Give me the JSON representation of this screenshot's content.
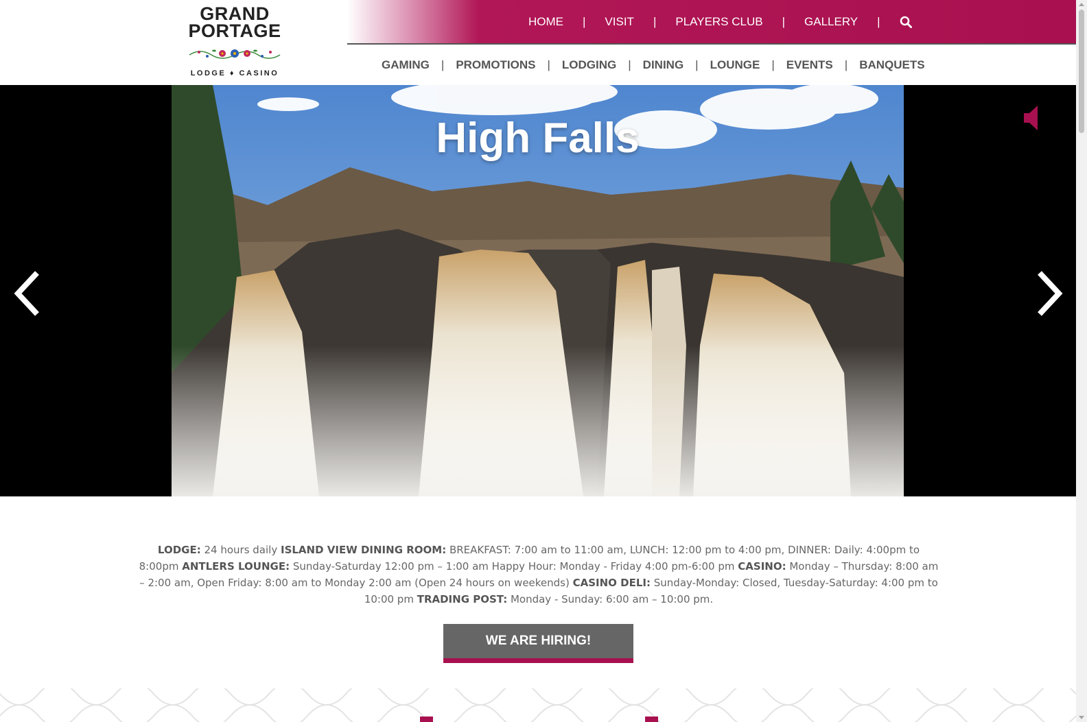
{
  "logo": {
    "line1": "GRAND",
    "line2": "PORTAGE",
    "subtitle": "LODGE ♦ CASINO"
  },
  "top_nav": {
    "items": [
      {
        "label": "HOME"
      },
      {
        "label": "VISIT"
      },
      {
        "label": "PLAYERS CLUB"
      },
      {
        "label": "GALLERY"
      }
    ],
    "separator": "|",
    "search_icon": "search-icon"
  },
  "main_nav": {
    "items": [
      {
        "label": "GAMING"
      },
      {
        "label": "PROMOTIONS"
      },
      {
        "label": "LODGING"
      },
      {
        "label": "DINING"
      },
      {
        "label": "LOUNGE"
      },
      {
        "label": "EVENTS"
      },
      {
        "label": "BANQUETS"
      }
    ],
    "separator": "|"
  },
  "hero": {
    "title": "High Falls",
    "prev_icon": "chevron-left-icon",
    "next_icon": "chevron-right-icon",
    "mute_icon": "speaker-mute-icon"
  },
  "hours": {
    "lodge_label": "LODGE:",
    "lodge_text": " 24 hours daily ",
    "dining_label": "ISLAND VIEW DINING ROOM:",
    "dining_text": " BREAKFAST: 7:00 am to 11:00 am, LUNCH: 12:00 pm to 4:00 pm, DINNER: Daily: 4:00pm to 8:00pm ",
    "lounge_label": "ANTLERS LOUNGE:",
    "lounge_text": " Sunday-Saturday 12:00 pm – 1:00 am Happy Hour: Monday - Friday 4:00 pm-6:00 pm ",
    "casino_label": "CASINO:",
    "casino_text": " Monday – Thursday: 8:00 am – 2:00 am, Open Friday: 8:00 am to Monday 2:00 am (Open 24 hours on weekends) ",
    "deli_label": "CASINO DELI:",
    "deli_text": " Sunday-Monday: Closed, Tuesday-Saturday: 4:00 pm to 10:00 pm ",
    "post_label": "TRADING POST:",
    "post_text": " Monday - Sunday: 6:00 am – 10:00 pm."
  },
  "hire_button": {
    "label": "WE ARE HIRING!"
  },
  "colors": {
    "brand": "#a8104f",
    "button_gray": "#666666",
    "text_gray": "#555555"
  }
}
